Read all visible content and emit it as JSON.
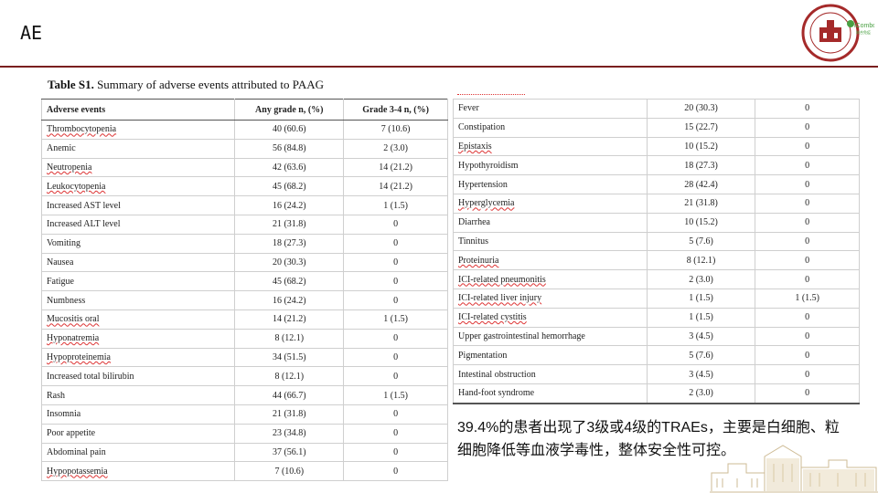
{
  "slide": {
    "title": "AE"
  },
  "logo": {
    "text": "iCombo",
    "sub": "联合免疫"
  },
  "caption": {
    "bold": "Table S1.",
    "text": " Summary of adverse events attributed to PAAG"
  },
  "table": {
    "headers": [
      "Adverse events",
      "Any grade n, (%)",
      "Grade 3-4 n, (%)"
    ],
    "left_rows": [
      [
        "Thrombocytopenia",
        "40 (60.6)",
        "7 (10.6)"
      ],
      [
        "Anemic",
        "56 (84.8)",
        "2 (3.0)"
      ],
      [
        "Neutropenia",
        "42 (63.6)",
        "14 (21.2)"
      ],
      [
        "Leukocytopenia",
        "45 (68.2)",
        "14 (21.2)"
      ],
      [
        "Increased AST level",
        "16 (24.2)",
        "1 (1.5)"
      ],
      [
        "Increased ALT level",
        "21 (31.8)",
        "0"
      ],
      [
        "Vomiting",
        "18 (27.3)",
        "0"
      ],
      [
        "Nausea",
        "20 (30.3)",
        "0"
      ],
      [
        "Fatigue",
        "45 (68.2)",
        "0"
      ],
      [
        "Numbness",
        "16 (24.2)",
        "0"
      ],
      [
        "Mucositis oral",
        "14 (21.2)",
        "1 (1.5)"
      ],
      [
        "Hyponatremia",
        "8 (12.1)",
        "0"
      ],
      [
        "Hypoproteinemia",
        "34 (51.5)",
        "0"
      ],
      [
        "Increased total bilirubin",
        "8 (12.1)",
        "0"
      ],
      [
        "Rash",
        "44 (66.7)",
        "1 (1.5)"
      ],
      [
        "Insomnia",
        "21 (31.8)",
        "0"
      ],
      [
        "Poor appetite",
        "23 (34.8)",
        "0"
      ],
      [
        "Abdominal pain",
        "37 (56.1)",
        "0"
      ],
      [
        "Hypopotassemia",
        "7 (10.6)",
        "0"
      ]
    ],
    "right_rows": [
      [
        "Fever",
        "20 (30.3)",
        "0"
      ],
      [
        "Constipation",
        "15 (22.7)",
        "0"
      ],
      [
        "Epistaxis",
        "10 (15.2)",
        "0"
      ],
      [
        "Hypothyroidism",
        "18 (27.3)",
        "0"
      ],
      [
        "Hypertension",
        "28 (42.4)",
        "0"
      ],
      [
        "Hyperglycemia",
        "21 (31.8)",
        "0"
      ],
      [
        "Diarrhea",
        "10 (15.2)",
        "0"
      ],
      [
        "Tinnitus",
        "5 (7.6)",
        "0"
      ],
      [
        "Proteinuria",
        "8 (12.1)",
        "0"
      ],
      [
        "ICI-related pneumonitis",
        "2 (3.0)",
        "0"
      ],
      [
        "ICI-related liver injury",
        "1 (1.5)",
        "1 (1.5)"
      ],
      [
        "ICI-related cystitis",
        "1 (1.5)",
        "0"
      ],
      [
        "Upper gastrointestinal hemorrhage",
        "3 (4.5)",
        "0"
      ],
      [
        "Pigmentation",
        "5 (7.6)",
        "0"
      ],
      [
        "Intestinal obstruction",
        "3 (4.5)",
        "0"
      ],
      [
        "Hand-foot syndrome",
        "2 (3.0)",
        "0"
      ]
    ]
  },
  "note": {
    "text": "39.4%的患者出现了3级或4级的TRAEs，主要是白细胞、粒细胞降低等血液学毒性，整体安全性可控。"
  },
  "colors": {
    "accent": "#7a1f1f",
    "logo_green": "#4aa043"
  }
}
